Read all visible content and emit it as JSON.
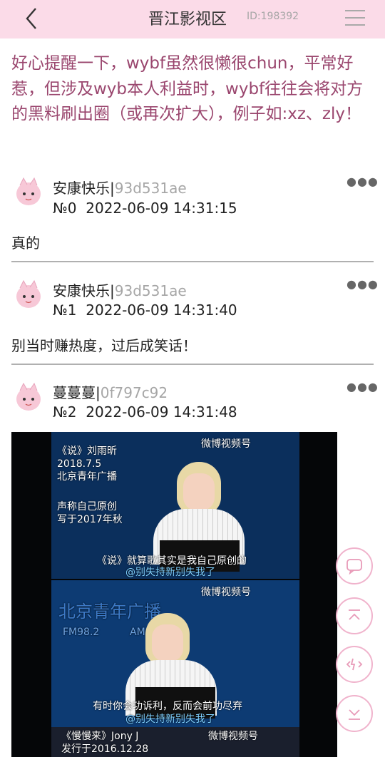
{
  "header": {
    "title": "晋江影视区",
    "thread_id": "ID:198392"
  },
  "post": {
    "title": "好心提醒一下，wybf虽然很懒很chun，平常好惹，但涉及wyb本人利益时，wybf往往会将对方的黑料刷出圈（或再次扩大），例子如:xz、zly！"
  },
  "replies": [
    {
      "author_name": "安康快乐",
      "author_hash": "93d531ae",
      "meta": "№0  2022-06-09 14:31:15",
      "text": "真的"
    },
    {
      "author_name": "安康快乐",
      "author_hash": "93d531ae",
      "meta": "№1  2022-06-09 14:31:40",
      "text": "别当时赚热度，过后成笑话！"
    },
    {
      "author_name": "蔓蔓蔓",
      "author_hash": "0f797c92",
      "meta": "№2  2022-06-09 14:31:48"
    }
  ],
  "image": {
    "caption_top": "《说》刘雨昕\n2018.7.5\n北京青年广播",
    "claim": "声称自己原创\n写于2017年秋",
    "subtitle_1": "《说》就算歌其实是我自己原创的",
    "watermark": "@别失持新别失我了",
    "weibo_mark": "微博视频号",
    "station_name": "北京青年广播",
    "station_freq": "FM98.2",
    "station_am": "AM",
    "subtitle_2": "有时你会功诉利，反而会前功尽弃",
    "caption_bottom": "《慢慢来》Jony J\n发行于2016.12.28"
  },
  "icons": {
    "back": "back-chevron-icon",
    "menu": "hamburger-menu-icon",
    "more": "more-dots-icon",
    "comment": "comment-icon",
    "top": "scroll-to-top-icon",
    "refresh": "refresh-icon",
    "bottom": "scroll-to-bottom-icon"
  },
  "colors": {
    "header_bg": "#fbdbe8",
    "title_text": "#9a466e",
    "float_border": "#f0b3cc"
  }
}
